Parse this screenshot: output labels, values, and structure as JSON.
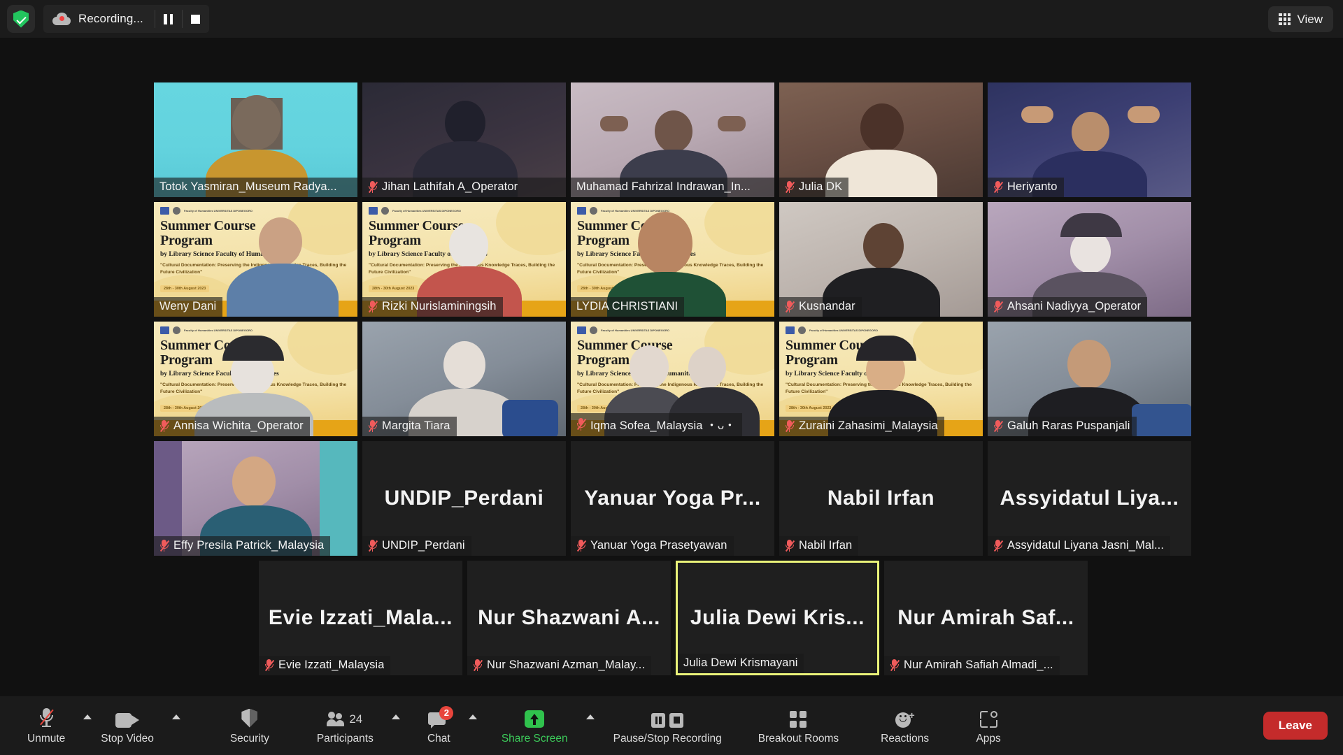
{
  "topbar": {
    "shield_icon": "security-shield-icon",
    "recording": {
      "icon": "cloud-recording-icon",
      "label": "Recording...",
      "pause_icon": "pause-icon",
      "stop_icon": "stop-icon"
    },
    "view": {
      "icon": "grid-view-icon",
      "label": "View"
    }
  },
  "slide_background": {
    "org_line": "Faculty of Humanities UNIVERSITAS DIPONEGORO",
    "title_line1": "Summer Course",
    "title_line2": "Program",
    "subtitle": "by Library Science Faculty of Humanities",
    "theme": "\"Cultural Documentation: Preserving the Indigenous Knowledge Traces, Building the Future Civilization\"",
    "date": "28th - 30th August 2023"
  },
  "grid": {
    "rows": [
      {
        "tiles": [
          {
            "name": "Totok Yasmiran_Museum Radya...",
            "muted": false,
            "kind": "video",
            "bg": "teal",
            "active": false
          },
          {
            "name": "Jihan Lathifah A_Operator",
            "muted": true,
            "kind": "video",
            "bg": "dim",
            "active": false
          },
          {
            "name": "Muhamad Fahrizal Indrawan_In...",
            "muted": false,
            "kind": "video",
            "bg": "room",
            "active": false
          },
          {
            "name": "Julia DK",
            "muted": true,
            "kind": "video",
            "bg": "warm",
            "active": false
          },
          {
            "name": "Heriyanto",
            "muted": true,
            "kind": "video",
            "bg": "indigo",
            "active": false
          }
        ]
      },
      {
        "tiles": [
          {
            "name": "Weny Dani",
            "muted": false,
            "kind": "slide",
            "bg": "slide",
            "active": false
          },
          {
            "name": "Rizki Nurislaminingsih",
            "muted": true,
            "kind": "slide",
            "bg": "slide",
            "active": false
          },
          {
            "name": "LYDIA CHRISTIANI",
            "muted": false,
            "kind": "slide",
            "bg": "slide",
            "active": false
          },
          {
            "name": "Kusnandar",
            "muted": true,
            "kind": "video",
            "bg": "pale",
            "active": false
          },
          {
            "name": "Ahsani Nadiyya_Operator",
            "muted": true,
            "kind": "video",
            "bg": "lilac",
            "active": false
          }
        ]
      },
      {
        "tiles": [
          {
            "name": "Annisa Wichita_Operator",
            "muted": true,
            "kind": "slide",
            "bg": "slide",
            "active": false
          },
          {
            "name": "Margita Tiara",
            "muted": true,
            "kind": "video",
            "bg": "bluegrey",
            "active": false
          },
          {
            "name": "Iqma Sofea_Malaysia ・ᴗ・",
            "muted": true,
            "kind": "slide",
            "bg": "slide",
            "active": false
          },
          {
            "name": "Zuraini Zahasimi_Malaysia",
            "muted": true,
            "kind": "slide",
            "bg": "slide",
            "active": false
          },
          {
            "name": "Galuh Raras Puspanjali",
            "muted": true,
            "kind": "video",
            "bg": "bluegrey",
            "active": false
          }
        ]
      },
      {
        "tiles": [
          {
            "name": "Effy Presila Patrick_Malaysia",
            "muted": true,
            "kind": "video",
            "bg": "lilac",
            "active": false
          },
          {
            "name": "UNDIP_Perdani",
            "muted": true,
            "kind": "name",
            "display": "UNDIP_Perdani",
            "active": false
          },
          {
            "name": "Yanuar Yoga Prasetyawan",
            "muted": true,
            "kind": "name",
            "display": "Yanuar Yoga Pr...",
            "active": false
          },
          {
            "name": "Nabil Irfan",
            "muted": true,
            "kind": "name",
            "display": "Nabil Irfan",
            "active": false
          },
          {
            "name": "Assyidatul Liyana Jasni_Mal...",
            "muted": true,
            "kind": "name",
            "display": "Assyidatul  Liya...",
            "active": false
          }
        ]
      },
      {
        "tiles": [
          {
            "name": "Evie Izzati_Malaysia",
            "muted": true,
            "kind": "name",
            "display": "Evie  Izzati_Mala...",
            "active": false
          },
          {
            "name": "Nur Shazwani Azman_Malay...",
            "muted": true,
            "kind": "name",
            "display": "Nur Shazwani A...",
            "active": false
          },
          {
            "name": "Julia Dewi Krismayani",
            "muted": false,
            "kind": "name",
            "display": "Julia Dewi Kris...",
            "active": true
          },
          {
            "name": "Nur Amirah Safiah Almadi_...",
            "muted": true,
            "kind": "name",
            "display": "Nur Amirah Saf...",
            "active": false
          }
        ]
      }
    ]
  },
  "toolbar": {
    "items": [
      {
        "id": "unmute",
        "label": "Unmute",
        "icon": "microphone-muted-icon",
        "caret": true,
        "accent": "default"
      },
      {
        "id": "stop-video",
        "label": "Stop Video",
        "icon": "camera-icon",
        "caret": true,
        "accent": "default"
      },
      {
        "id": "security",
        "label": "Security",
        "icon": "shield-icon",
        "caret": false,
        "accent": "default"
      },
      {
        "id": "participants",
        "label": "Participants",
        "icon": "people-icon",
        "count": "24",
        "caret": true,
        "accent": "default"
      },
      {
        "id": "chat",
        "label": "Chat",
        "icon": "chat-bubble-icon",
        "badge": "2",
        "caret": true,
        "accent": "default"
      },
      {
        "id": "share-screen",
        "label": "Share Screen",
        "icon": "share-screen-icon",
        "caret": true,
        "accent": "green"
      },
      {
        "id": "pause-stop-recording",
        "label": "Pause/Stop Recording",
        "icon": "pause-stop-recording-icon",
        "caret": false,
        "accent": "default"
      },
      {
        "id": "breakout-rooms",
        "label": "Breakout Rooms",
        "icon": "breakout-rooms-icon",
        "caret": false,
        "accent": "default"
      },
      {
        "id": "reactions",
        "label": "Reactions",
        "icon": "reactions-icon",
        "caret": false,
        "accent": "default"
      },
      {
        "id": "apps",
        "label": "Apps",
        "icon": "apps-icon",
        "caret": false,
        "accent": "default"
      }
    ],
    "leave_label": "Leave"
  },
  "colors": {
    "active_speaker_border": "#e9f279",
    "leave_red": "#c42b2b",
    "share_green": "#3ccb5a",
    "badge_red": "#e8453c",
    "muted_mic_red": "#f05b5b"
  }
}
